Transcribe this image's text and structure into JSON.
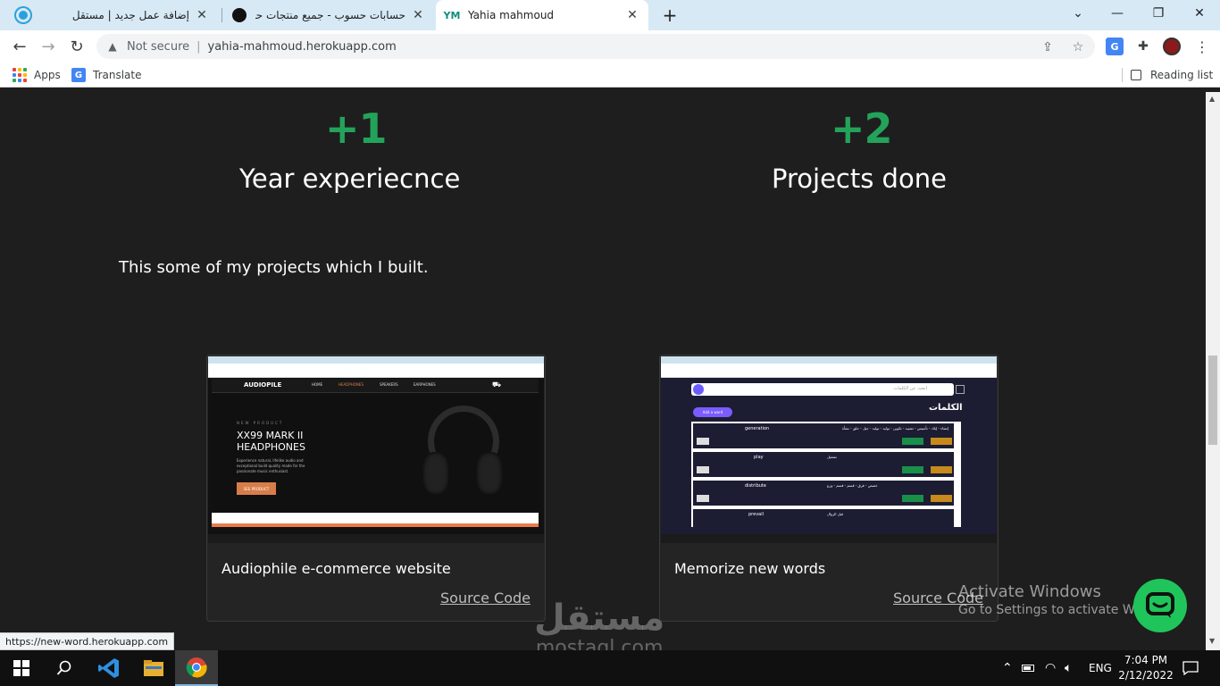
{
  "browser": {
    "tabs": [
      {
        "title": "إضافة عمل جديد | مستقل",
        "active": false
      },
      {
        "title": "حسابات حسوب - جميع منتجات حسوب",
        "active": false
      },
      {
        "title": "Yahia mahmoud",
        "active": true
      }
    ],
    "security_label": "Not secure",
    "url": "yahia-mahmoud.herokuapp.com",
    "bookmarks": [
      {
        "label": "Apps"
      },
      {
        "label": "Translate"
      }
    ],
    "reading_list": "Reading list",
    "status_url": "https://new-word.herokuapp.com"
  },
  "page": {
    "stats": [
      {
        "number": "+1",
        "label": "Year experiecnce"
      },
      {
        "number": "+2",
        "label": "Projects done"
      }
    ],
    "intro": "This some of my projects which I built.",
    "projects": [
      {
        "name": "Audiophile e-commerce website",
        "link": "Source Code",
        "preview": {
          "brand": "AUDIOPILE",
          "nav": [
            "HOME",
            "HEADPHONES",
            "SPEAKERS",
            "EARPHONES"
          ],
          "kicker": "NEW PRODUCT",
          "headline_1": "XX99 MARK II",
          "headline_2": "HEADPHONES",
          "body_1": "Experience natural, lifelike audio and",
          "body_2": "exceptional build quality made for the",
          "body_3": "passionate music enthusiast.",
          "cta": "SEE PRODUCT"
        }
      },
      {
        "name": "Memorize new words",
        "link": "Source Code",
        "preview": {
          "heading": "الكلمات",
          "search": "ابحث عن الكلمات",
          "button": "Add a word",
          "words": [
            {
              "en": "generation",
              "ar": "إنشاء - إيلاد - تأسيس - تشييد - تكوين - توليد - توليد - جيل - خلق - نشأة"
            },
            {
              "en": "play",
              "ar": "تشغيل"
            },
            {
              "en": "distribute",
              "ar": "خصص - فرق - قسم - قسم - وزع"
            },
            {
              "en": "prevail",
              "ar": "قبل الزوال"
            }
          ]
        }
      }
    ]
  },
  "overlays": {
    "activate_title": "Activate Windows",
    "activate_sub": "Go to Settings to activate Windows.",
    "watermark_ar": "مستقل",
    "watermark_en": "mostaql.com"
  },
  "taskbar": {
    "tray_lang": "ENG",
    "time": "7:04 PM",
    "date": "2/12/2022"
  },
  "colors": {
    "accent_green": "#23a35a",
    "chat_green": "#1fc55a",
    "page_bg": "#1e1e1e"
  }
}
